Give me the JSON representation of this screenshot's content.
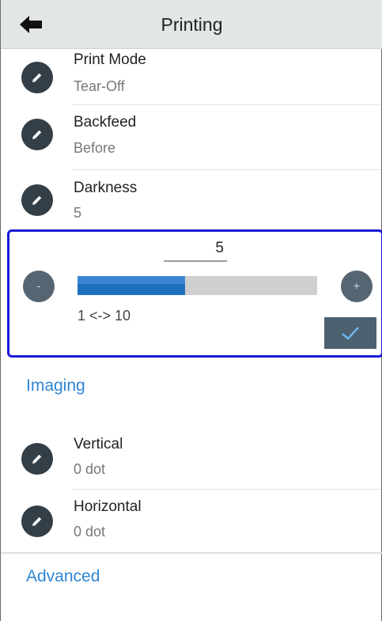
{
  "header": {
    "title": "Printing"
  },
  "print_mode": {
    "label": "Print Mode",
    "value": "Tear-Off"
  },
  "backfeed": {
    "label": "Backfeed",
    "value": "Before"
  },
  "darkness": {
    "label": "Darkness",
    "value": "5"
  },
  "slider": {
    "value": "5",
    "min": 1,
    "max": 10,
    "fill_fraction": 0.45,
    "range_label": "1 <-> 10",
    "minus_symbol": "-",
    "plus_symbol": "+"
  },
  "imaging": {
    "title": "Imaging"
  },
  "vertical": {
    "label": "Vertical",
    "value": "0 dot"
  },
  "horizontal": {
    "label": "Horizontal",
    "value": "0 dot"
  },
  "advanced": {
    "title": "Advanced"
  },
  "colors": {
    "accent": "#2f86d6",
    "focus_border": "#1a1ad6",
    "icon_dark": "#333e47",
    "slider_fill": "#1f6fc0"
  },
  "icons": {
    "back": "arrow-left-icon",
    "edit": "pencil-icon",
    "confirm": "checkmark-icon"
  }
}
